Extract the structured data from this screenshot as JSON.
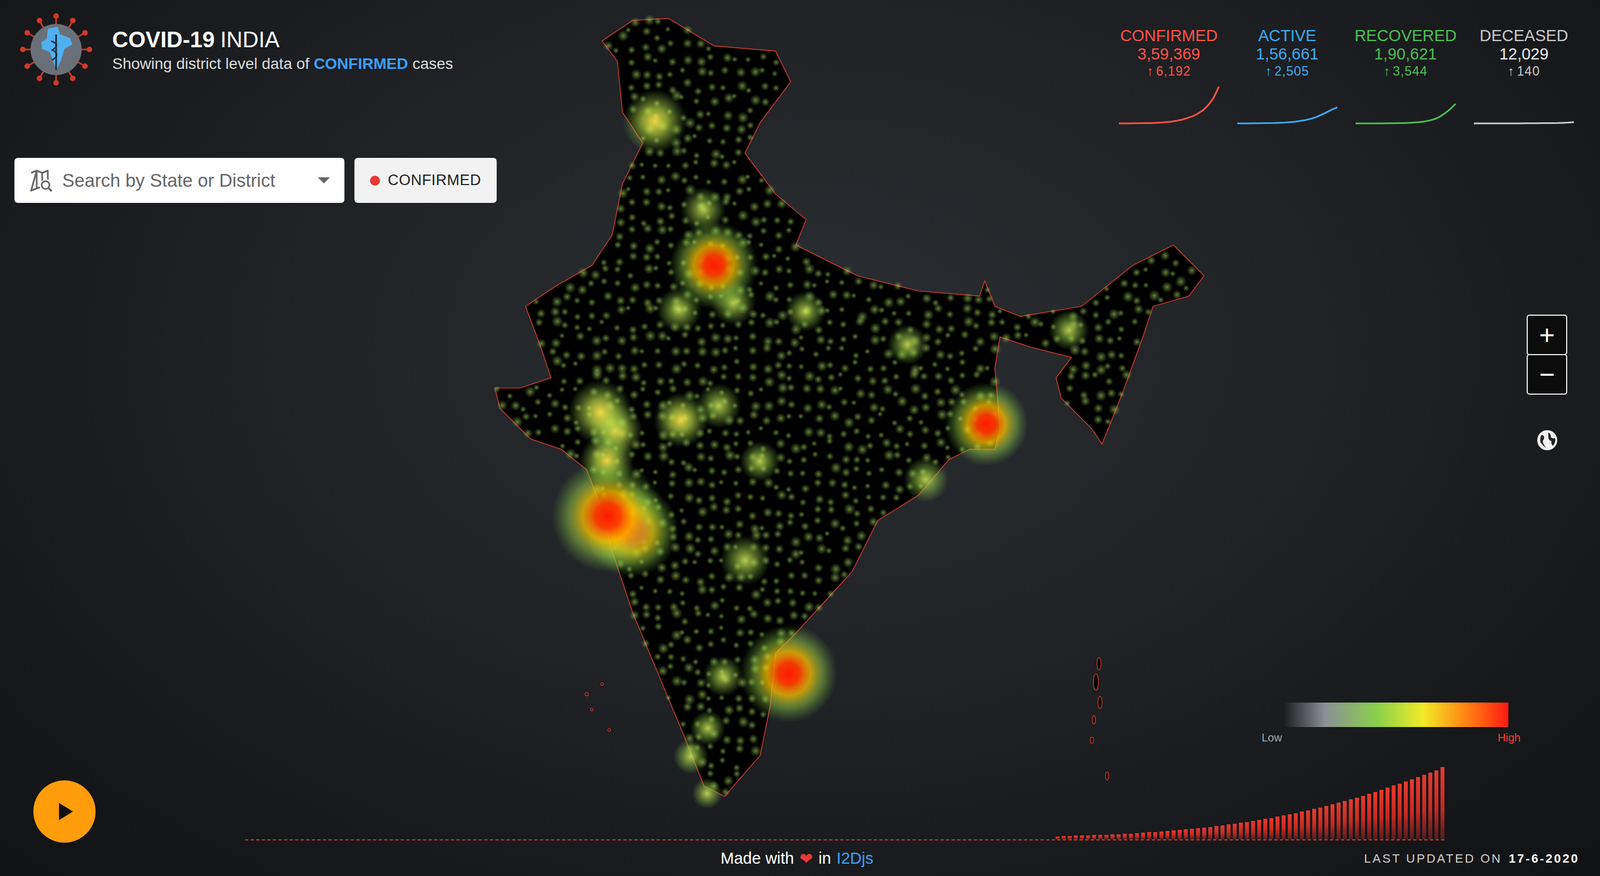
{
  "header": {
    "title_bold": "COVID-19",
    "title_rest": "INDIA",
    "subtitle_pre": "Showing district level data of",
    "subtitle_metric": "CONFIRMED",
    "subtitle_post": "cases"
  },
  "search": {
    "placeholder": "Search by State or District"
  },
  "metric_button": {
    "label": "CONFIRMED",
    "color": "#e53935"
  },
  "stats": [
    {
      "label": "CONFIRMED",
      "value": "3,59,369",
      "arrow": "↑",
      "delta": "6,192",
      "color": "#ff5247",
      "series": [
        0,
        0,
        0,
        1,
        1,
        2,
        3,
        5,
        8,
        12,
        18,
        26,
        37,
        52,
        70,
        95,
        130,
        180,
        250,
        359
      ]
    },
    {
      "label": "ACTIVE",
      "value": "1,56,661",
      "arrow": "↑",
      "delta": "2,505",
      "color": "#3aacf5",
      "series": [
        0,
        0,
        0,
        1,
        1,
        2,
        3,
        4,
        6,
        8,
        12,
        17,
        24,
        33,
        45,
        62,
        85,
        110,
        135,
        157
      ]
    },
    {
      "label": "RECOVERED",
      "value": "1,90,621",
      "arrow": "↑",
      "delta": "3,544",
      "color": "#4cbf55",
      "series": [
        0,
        0,
        0,
        0,
        0,
        0,
        1,
        1,
        2,
        3,
        5,
        8,
        12,
        18,
        28,
        42,
        65,
        100,
        140,
        191
      ]
    },
    {
      "label": "DECEASED",
      "value": "12,029",
      "arrow": "↑",
      "delta": "140",
      "color": "#c9c9c9",
      "series": [
        0,
        0,
        0,
        0,
        0,
        0,
        0,
        0,
        0,
        0,
        1,
        1,
        1,
        2,
        2,
        3,
        4,
        6,
        8,
        12
      ]
    }
  ],
  "map": {
    "hotspots": [
      {
        "lat": 19.07,
        "lon": 72.87,
        "level": 1.0
      },
      {
        "lat": 18.52,
        "lon": 73.86,
        "level": 0.8
      },
      {
        "lat": 28.61,
        "lon": 77.21,
        "level": 0.75
      },
      {
        "lat": 13.08,
        "lon": 80.27,
        "level": 0.85
      },
      {
        "lat": 22.57,
        "lon": 88.36,
        "level": 0.7
      },
      {
        "lat": 23.02,
        "lon": 72.57,
        "level": 0.5
      },
      {
        "lat": 22.31,
        "lon": 73.18,
        "level": 0.4
      },
      {
        "lat": 21.17,
        "lon": 72.83,
        "level": 0.4
      },
      {
        "lat": 34.08,
        "lon": 74.8,
        "level": 0.5
      },
      {
        "lat": 22.72,
        "lon": 75.86,
        "level": 0.4
      },
      {
        "lat": 17.38,
        "lon": 78.49,
        "level": 0.35
      },
      {
        "lat": 26.91,
        "lon": 75.79,
        "level": 0.3
      },
      {
        "lat": 23.26,
        "lon": 77.41,
        "level": 0.3
      },
      {
        "lat": 26.85,
        "lon": 80.95,
        "level": 0.25
      },
      {
        "lat": 25.59,
        "lon": 85.14,
        "level": 0.25
      },
      {
        "lat": 12.97,
        "lon": 77.59,
        "level": 0.25
      },
      {
        "lat": 26.14,
        "lon": 91.74,
        "level": 0.25
      },
      {
        "lat": 27.18,
        "lon": 78.01,
        "level": 0.3
      },
      {
        "lat": 30.73,
        "lon": 76.78,
        "level": 0.3
      },
      {
        "lat": 21.15,
        "lon": 79.09,
        "level": 0.25
      },
      {
        "lat": 20.46,
        "lon": 85.88,
        "level": 0.3
      },
      {
        "lat": 9.93,
        "lon": 76.27,
        "level": 0.2
      },
      {
        "lat": 11.0,
        "lon": 76.96,
        "level": 0.2
      },
      {
        "lat": 8.52,
        "lon": 76.94,
        "level": 0.15
      }
    ]
  },
  "zoom": {
    "in": "+",
    "out": "−"
  },
  "legend": {
    "low": "Low",
    "high": "High"
  },
  "timeline": {
    "values": [
      15,
      16,
      17,
      18,
      19,
      20,
      21,
      22,
      23,
      25,
      26,
      28,
      29,
      31,
      33,
      35,
      37,
      39,
      42,
      44,
      47,
      49,
      52,
      56,
      59,
      62,
      66,
      70,
      74,
      78,
      82,
      86,
      91,
      96,
      101,
      106,
      112,
      118,
      125,
      131,
      138,
      145,
      151,
      158,
      165,
      173,
      182,
      190,
      198,
      207,
      216,
      226,
      236,
      246,
      257,
      267,
      276,
      286,
      297,
      308,
      320,
      332,
      343,
      359
    ]
  },
  "footer": {
    "made_with": "Made with",
    "heart": "❤",
    "in": "in",
    "brand": "I2Djs",
    "updated_label": "LAST UPDATED ON",
    "updated_date": "17-6-2020"
  }
}
